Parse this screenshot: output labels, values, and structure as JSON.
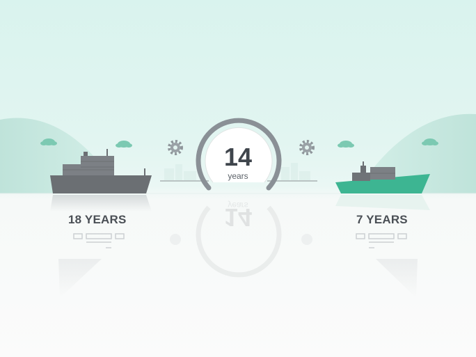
{
  "comparison": {
    "left": {
      "label": "18 YEARS",
      "ship_color": "#6b6f73"
    },
    "center": {
      "value": "14",
      "unit": "years"
    },
    "right": {
      "label": "7 YEARS",
      "ship_color": "#3db592"
    }
  },
  "icons": [
    "cloud-icon",
    "gear-icon",
    "ship-icon",
    "container-stack-icon"
  ],
  "colors": {
    "sky": "#dff4ef",
    "hills": "#c7e8e1",
    "ground": "#f7f9f8",
    "text": "#4a4f55",
    "accent": "#3db592"
  }
}
